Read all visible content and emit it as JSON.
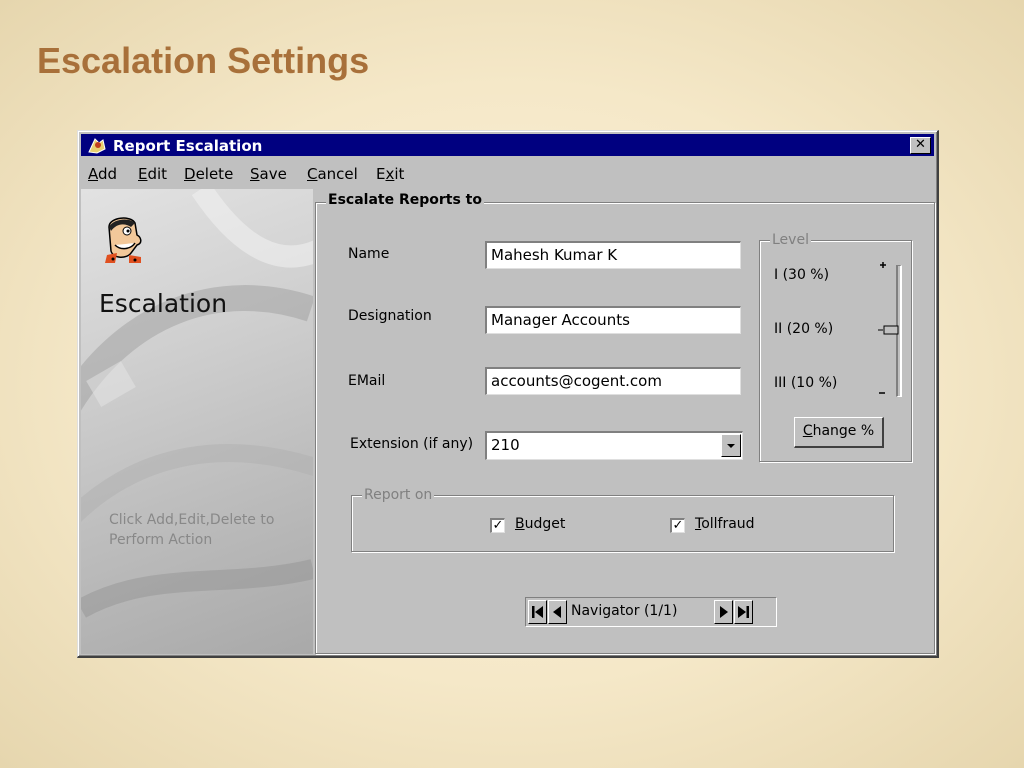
{
  "slide": {
    "title": "Escalation Settings"
  },
  "window": {
    "title": "Report Escalation",
    "close_label": "✕",
    "menu": [
      {
        "key": "A",
        "rest": "dd"
      },
      {
        "key": "E",
        "rest": "dit"
      },
      {
        "key": "D",
        "rest": "elete"
      },
      {
        "key": "S",
        "rest": "ave"
      },
      {
        "key": "C",
        "rest": "ancel"
      },
      {
        "pre": "E",
        "key": "x",
        "rest": "it"
      }
    ]
  },
  "side": {
    "title": "Escalation",
    "hint": "Click Add,Edit,Delete to Perform Action"
  },
  "form": {
    "group_title": "Escalate Reports to",
    "name_label": "Name",
    "name_value": "Mahesh Kumar K",
    "designation_label": "Designation",
    "designation_value": "Manager Accounts",
    "email_label": "EMail",
    "email_value": "accounts@cogent.com",
    "extension_label": "Extension (if any)",
    "extension_value": "210"
  },
  "level": {
    "group_title": "Level",
    "items": [
      "I  (30 %)",
      "II  (20 %)",
      "III (10 %)"
    ],
    "selected_index": 1,
    "change_button": {
      "key": "C",
      "rest": "hange %"
    }
  },
  "report_on": {
    "group_title": "Report on",
    "budget": {
      "key": "B",
      "rest": "udget",
      "checked": true
    },
    "tollfraud": {
      "key": "T",
      "rest": "ollfraud",
      "checked": true
    },
    "check_glyph": "✓"
  },
  "navigator": {
    "label": "Navigator (1/1)"
  },
  "colors": {
    "titlebar": "#000080",
    "window_bg": "#c0c0c0",
    "slide_title": "#a8703a"
  }
}
